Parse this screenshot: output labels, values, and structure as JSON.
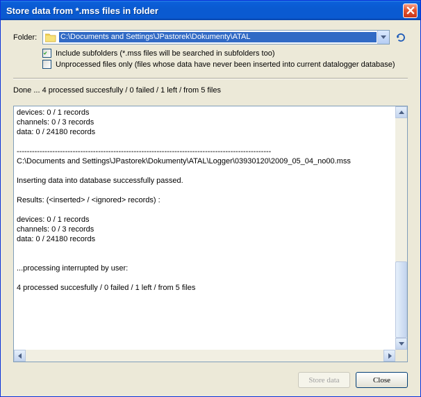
{
  "window": {
    "title": "Store data from *.mss files in folder"
  },
  "folder": {
    "label": "Folder:",
    "path": "C:\\Documents and Settings\\JPastorek\\Dokumenty\\ATAL"
  },
  "options": {
    "include_subfolders": {
      "checked": true,
      "label": "Include subfolders (*.mss files will be searched in subfolders too)"
    },
    "unprocessed_only": {
      "checked": false,
      "label": "Unprocessed files only (files whose data have never been inserted into current datalogger database)"
    }
  },
  "status": "Done ... 4 processed succesfully / 0 failed / 1 left / from 5 files",
  "log": "devices: 0 / 1 records\nchannels: 0 / 3 records\ndata: 0 / 24180 records\n\n----------------------------------------------------------------------------------------------------\nC:\\Documents and Settings\\JPastorek\\Dokumenty\\ATAL\\Logger\\03930120\\2009_05_04_no00.mss\n\nInserting data into database successfully passed.\n\nResults: (<inserted> / <ignored> records) :\n\ndevices: 0 / 1 records\nchannels: 0 / 3 records\ndata: 0 / 24180 records\n\n\n...processing interrupted by user:\n\n4 processed succesfully / 0 failed / 1 left / from 5 files\n",
  "buttons": {
    "store": "Store data",
    "close": "Close"
  }
}
